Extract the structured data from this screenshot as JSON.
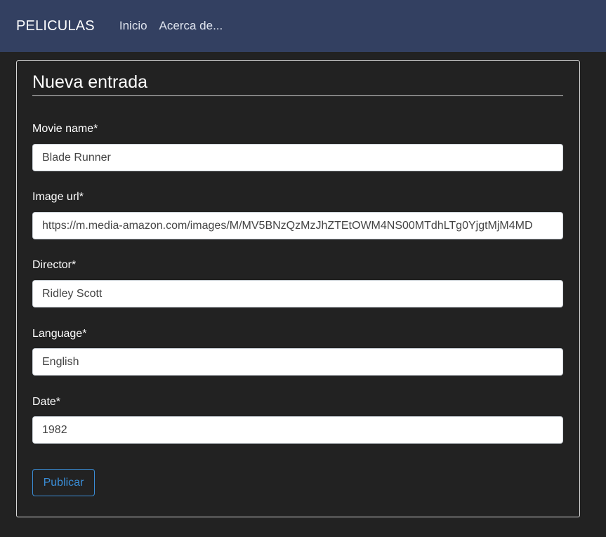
{
  "navbar": {
    "brand": "PELICULAS",
    "links": [
      "Inicio",
      "Acerca de..."
    ],
    "background": "#334061"
  },
  "form": {
    "title": "Nueva entrada",
    "fields": [
      {
        "label": "Movie name*",
        "value": "Blade Runner"
      },
      {
        "label": "Image url*",
        "value": "https://m.media-amazon.com/images/M/MV5BNzQzMzJhZTEtOWM4NS00MTdhLTg0YjgtMjM4MD"
      },
      {
        "label": "Director*",
        "value": "Ridley Scott"
      },
      {
        "label": "Language*",
        "value": "English"
      },
      {
        "label": "Date*",
        "value": "1982"
      }
    ],
    "submit_label": "Publicar",
    "accent": "#3a8dd6"
  }
}
